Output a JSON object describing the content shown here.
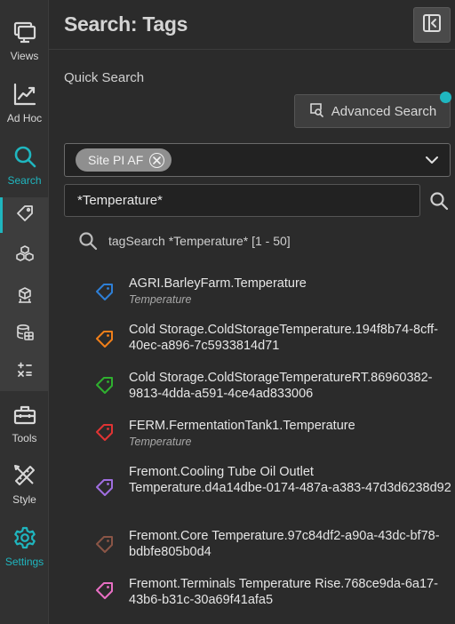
{
  "nav": {
    "items": [
      {
        "label": "Views",
        "icon": "views-icon"
      },
      {
        "label": "Ad Hoc",
        "icon": "chart-line-icon"
      },
      {
        "label": "Search",
        "icon": "search-icon"
      },
      {
        "label": "Tools",
        "icon": "toolbox-icon"
      },
      {
        "label": "Style",
        "icon": "brush-ruler-icon"
      },
      {
        "label": "Settings",
        "icon": "gear-icon"
      }
    ],
    "active": "Search",
    "sub_items": [
      "tag-icon",
      "cubes-icon",
      "asset-icon",
      "database-icon",
      "calculator-icon"
    ],
    "accent_color": "#1fb6bf"
  },
  "header": {
    "title": "Search: Tags"
  },
  "quick_search": {
    "label": "Quick Search",
    "advanced_button": "Advanced Search",
    "source_chip": "Site PI AF",
    "query": "*Temperature*",
    "summary": "tagSearch *Temperature* [1 - 50]"
  },
  "results": [
    {
      "name": "AGRI.BarleyFarm.Temperature",
      "description": "Temperature",
      "color": "#2e7fd6"
    },
    {
      "name": "Cold Storage.ColdStorageTemperature.194f8b74-8cff-40ec-a896-7c5933814d71",
      "description": "",
      "color": "#f07f1a"
    },
    {
      "name": "Cold Storage.ColdStorageTemperatureRT.86960382-9813-4dda-a591-4ce4ad833006",
      "description": "",
      "color": "#2fb02f"
    },
    {
      "name": "FERM.FermentationTank1.Temperature",
      "description": "Temperature",
      "color": "#e03434"
    },
    {
      "name": "Fremont.Cooling Tube Oil Outlet Temperature.d4a14dbe-0174-487a-a383-47d3d6238d92",
      "description": "",
      "color": "#a06ee0"
    },
    {
      "name": "Fremont.Core Temperature.97c84df2-a90a-43dc-bf78-bdbfe805b0d4",
      "description": "",
      "color": "#8a5546"
    },
    {
      "name": "Fremont.Terminals Temperature Rise.768ce9da-6a17-43b6-b31c-30a69f41afa5",
      "description": "",
      "color": "#e86fc4"
    }
  ]
}
